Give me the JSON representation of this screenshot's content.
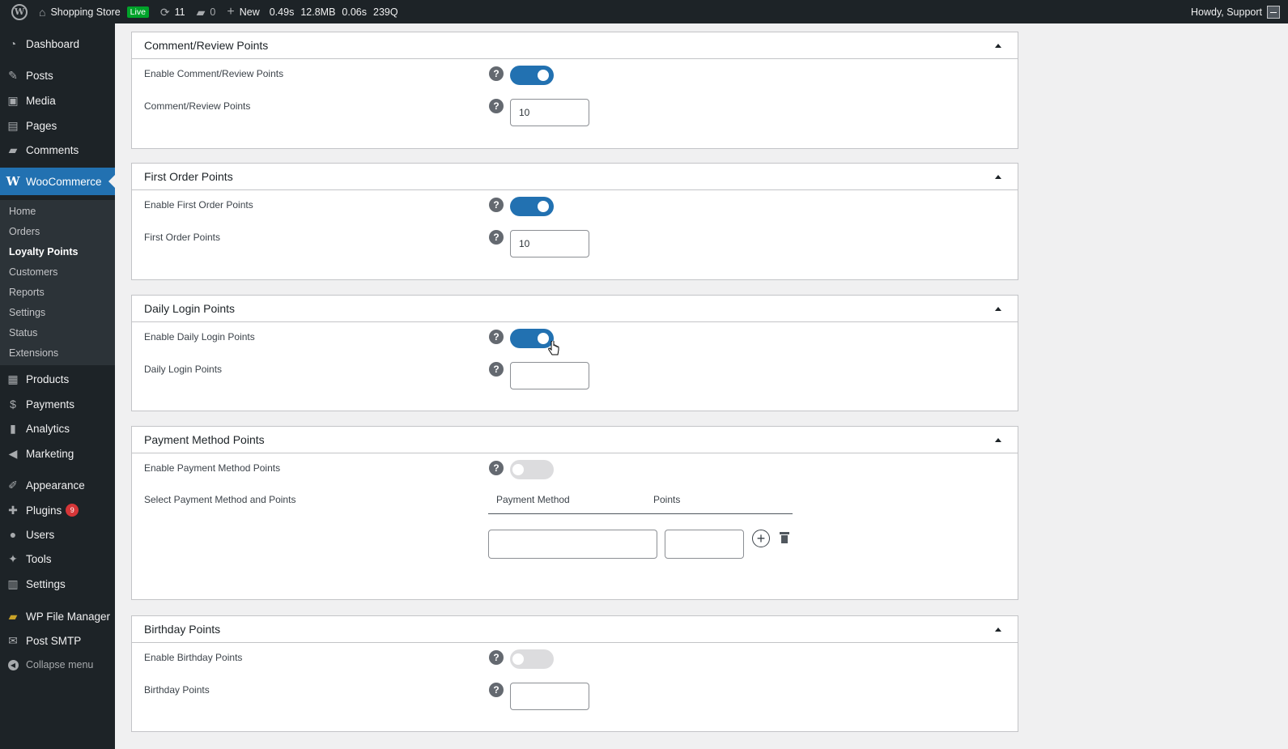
{
  "adminbar": {
    "site_name": "Shopping Store",
    "live_label": "Live",
    "updates_count": "11",
    "comments_count": "0",
    "new_label": "New",
    "stats": [
      "0.49s",
      "12.8MB",
      "0.06s",
      "239Q"
    ],
    "howdy": "Howdy, Support"
  },
  "sidebar": {
    "items": [
      {
        "label": "Dashboard",
        "icon": "dashboard-icon"
      },
      {
        "label": "Posts",
        "icon": "pin-icon"
      },
      {
        "label": "Media",
        "icon": "media-icon"
      },
      {
        "label": "Pages",
        "icon": "pages-icon"
      },
      {
        "label": "Comments",
        "icon": "comment-icon"
      },
      {
        "label": "WooCommerce",
        "icon": "woocommerce-icon"
      },
      {
        "label": "Products",
        "icon": "archive-icon"
      },
      {
        "label": "Payments",
        "icon": "payments-icon"
      },
      {
        "label": "Analytics",
        "icon": "bar-chart-icon"
      },
      {
        "label": "Marketing",
        "icon": "megaphone-icon"
      },
      {
        "label": "Appearance",
        "icon": "brush-icon"
      },
      {
        "label": "Plugins",
        "icon": "plug-icon",
        "badge": "9"
      },
      {
        "label": "Users",
        "icon": "user-icon"
      },
      {
        "label": "Tools",
        "icon": "wrench-icon"
      },
      {
        "label": "Settings",
        "icon": "settings-icon"
      },
      {
        "label": "WP File Manager",
        "icon": "folder-icon"
      },
      {
        "label": "Post SMTP",
        "icon": "mail-icon"
      },
      {
        "label": "Collapse menu",
        "icon": "collapse-icon"
      }
    ],
    "submenu": [
      "Home",
      "Orders",
      "Loyalty Points",
      "Customers",
      "Reports",
      "Settings",
      "Status",
      "Extensions"
    ],
    "active_submenu": "Loyalty Points"
  },
  "panels": {
    "comment": {
      "title": "Comment/Review Points",
      "enable_label": "Enable Comment/Review Points",
      "enabled": true,
      "points_label": "Comment/Review Points",
      "points_value": "10"
    },
    "first_order": {
      "title": "First Order Points",
      "enable_label": "Enable First Order Points",
      "enabled": true,
      "points_label": "First Order Points",
      "points_value": "10"
    },
    "daily_login": {
      "title": "Daily Login Points",
      "enable_label": "Enable Daily Login Points",
      "enabled": true,
      "points_label": "Daily Login Points",
      "points_value": ""
    },
    "payment_method": {
      "title": "Payment Method Points",
      "enable_label": "Enable Payment Method Points",
      "enabled": false,
      "select_label": "Select Payment Method and Points",
      "col_method": "Payment Method",
      "col_points": "Points"
    },
    "birthday": {
      "title": "Birthday Points",
      "enable_label": "Enable Birthday Points",
      "enabled": false,
      "points_label": "Birthday Points",
      "points_value": ""
    }
  },
  "colors": {
    "admin_dark": "#1d2327",
    "accent_blue": "#2271b1",
    "toggle_off": "#dcdcde",
    "badge_red": "#d63638",
    "live_green": "#00a32a"
  }
}
